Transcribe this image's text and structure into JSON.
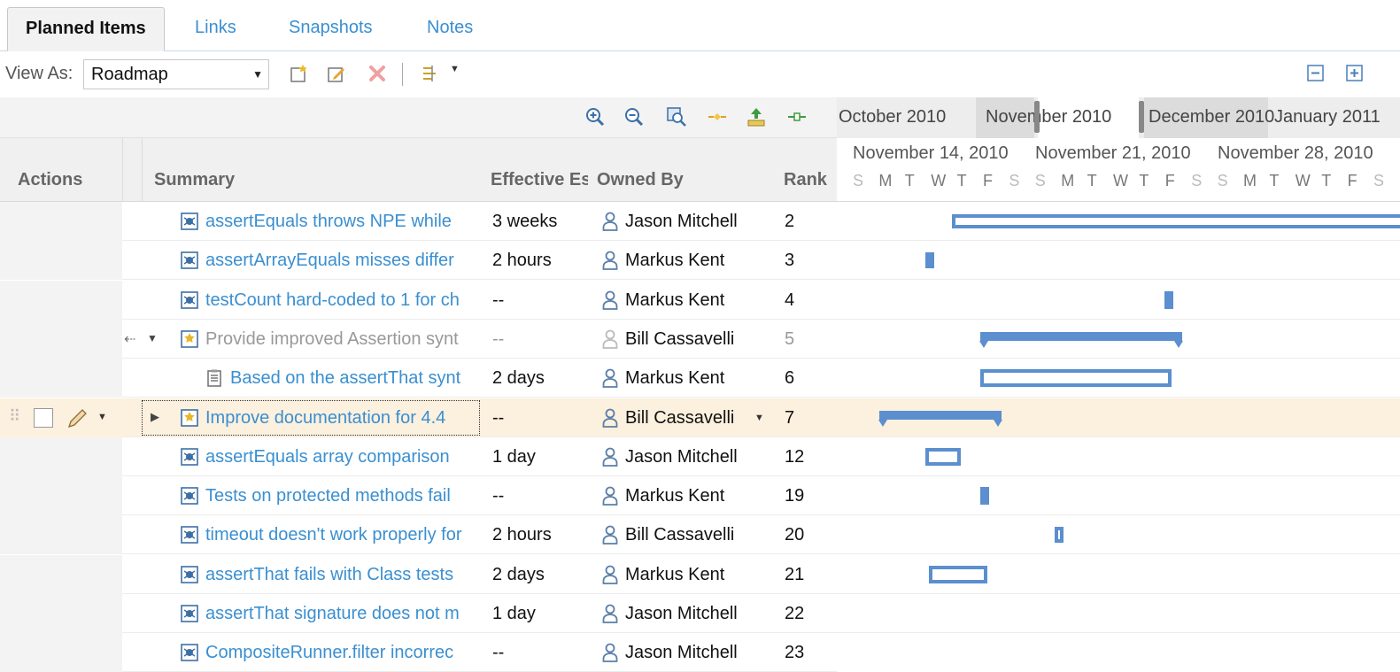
{
  "tabs": [
    {
      "label": "Planned Items",
      "active": true
    },
    {
      "label": "Links",
      "active": false
    },
    {
      "label": "Snapshots",
      "active": false
    },
    {
      "label": "Notes",
      "active": false
    }
  ],
  "toolbar": {
    "view_as_label": "View As:",
    "view_as_value": "Roadmap"
  },
  "columns": {
    "actions": "Actions",
    "summary": "Summary",
    "effective": "Effective Es",
    "owned_by": "Owned By",
    "rank": "Rank"
  },
  "timeline": {
    "months": [
      "October 2010",
      "November 2010",
      "December 2010",
      "January 2011"
    ],
    "weeks": [
      "November 14, 2010",
      "November 21, 2010",
      "November 28, 2010"
    ],
    "days": [
      "S",
      "M",
      "T",
      "W",
      "T",
      "F",
      "S",
      "S",
      "M",
      "T",
      "W",
      "T",
      "F",
      "S",
      "S",
      "M",
      "T",
      "W",
      "T",
      "F",
      "S"
    ]
  },
  "rows": [
    {
      "summary": "assertEquals throws NPE while",
      "estimate": "3 weeks",
      "owner": "Jason Mitchell",
      "rank": "2",
      "type": "defect"
    },
    {
      "summary": "assertArrayEquals misses differ",
      "estimate": "2 hours",
      "owner": "Markus Kent",
      "rank": "3",
      "type": "defect"
    },
    {
      "summary": "testCount hard-coded to 1 for ch",
      "estimate": "--",
      "owner": "Markus Kent",
      "rank": "4",
      "type": "defect"
    },
    {
      "summary": "Provide improved Assertion synt",
      "estimate": "--",
      "owner": "Bill Cassavelli",
      "rank": "5",
      "type": "story",
      "muted": true
    },
    {
      "summary": "Based on the assertThat synt",
      "estimate": "2 days",
      "owner": "Markus Kent",
      "rank": "6",
      "type": "task"
    },
    {
      "summary": "Improve documentation for 4.4",
      "estimate": "--",
      "owner": "Bill Cassavelli",
      "rank": "7",
      "type": "story",
      "selected": true
    },
    {
      "summary": "assertEquals array comparison",
      "estimate": "1 day",
      "owner": "Jason Mitchell",
      "rank": "12",
      "type": "defect"
    },
    {
      "summary": "Tests on protected methods fail",
      "estimate": "--",
      "owner": "Markus Kent",
      "rank": "19",
      "type": "defect"
    },
    {
      "summary": "timeout doesn't work properly for",
      "estimate": "2 hours",
      "owner": "Bill Cassavelli",
      "rank": "20",
      "type": "defect"
    },
    {
      "summary": "assertThat fails with Class tests",
      "estimate": "2 days",
      "owner": "Markus Kent",
      "rank": "21",
      "type": "defect"
    },
    {
      "summary": "assertThat signature does not m",
      "estimate": "1 day",
      "owner": "Jason Mitchell",
      "rank": "22",
      "type": "defect"
    },
    {
      "summary": "CompositeRunner.filter incorrec",
      "estimate": "--",
      "owner": "Jason Mitchell",
      "rank": "23",
      "type": "defect"
    }
  ],
  "colors": {
    "link": "#3a8fd0",
    "bar": "#5b8fcf",
    "selected_row": "#fcf0de"
  }
}
